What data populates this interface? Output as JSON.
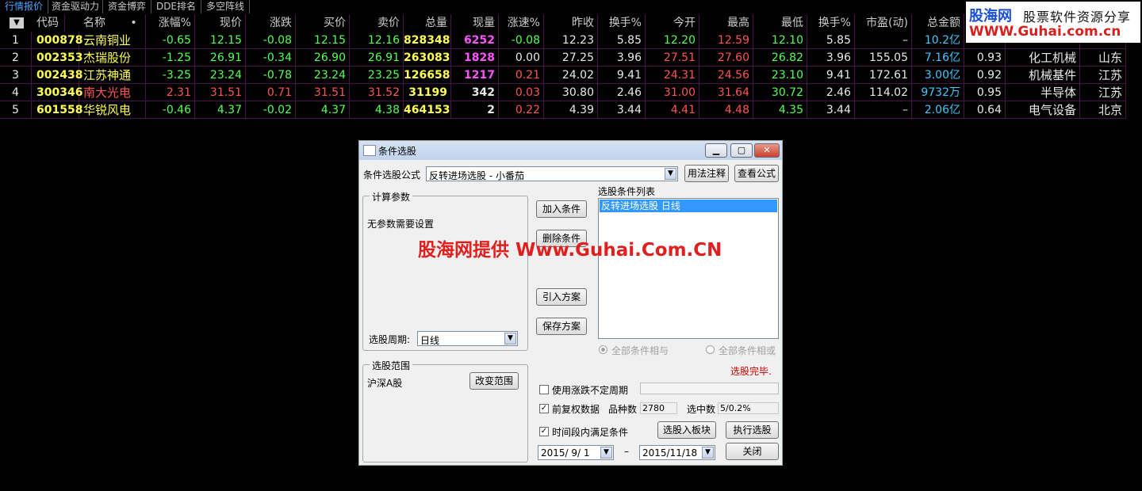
{
  "tabs": [
    "行情报价",
    "资金驱动力",
    "资金博弈",
    "DDE排名",
    "多空阵线"
  ],
  "table": {
    "headers": [
      "代码",
      "名称",
      "•",
      "涨幅%",
      "现价",
      "涨跌",
      "买价",
      "卖价",
      "总量",
      "现量",
      "涨速%",
      "昨收",
      "换手%",
      "今开",
      "最高",
      "最低",
      "换手%",
      "市盈(动)",
      "总金额"
    ],
    "rows": [
      {
        "idx": "1",
        "code": "000878",
        "name": "云南铜业",
        "chg_pct": "-0.65",
        "price": "12.15",
        "chg": "-0.08",
        "bid": "12.15",
        "ask": "12.16",
        "vol": "828348",
        "cur_vol": "6252",
        "speed": "-0.08",
        "prev": "12.23",
        "turn": "5.85",
        "open": "12.20",
        "high": "12.59",
        "low": "12.10",
        "turn2": "5.85",
        "pe": "–",
        "amount": "10.2亿",
        "ratio": "",
        "industry": "",
        "region": ""
      },
      {
        "idx": "2",
        "code": "002353",
        "name": "杰瑞股份",
        "chg_pct": "-1.25",
        "price": "26.91",
        "chg": "-0.34",
        "bid": "26.90",
        "ask": "26.91",
        "vol": "263083",
        "cur_vol": "1828",
        "speed": "0.00",
        "prev": "27.25",
        "turn": "3.96",
        "open": "27.51",
        "high": "27.60",
        "low": "26.82",
        "turn2": "3.96",
        "pe": "155.05",
        "amount": "7.16亿",
        "ratio": "0.93",
        "industry": "化工机械",
        "region": "山东"
      },
      {
        "idx": "3",
        "code": "002438",
        "name": "江苏神通",
        "chg_pct": "-3.25",
        "price": "23.24",
        "chg": "-0.78",
        "bid": "23.24",
        "ask": "23.25",
        "vol": "126658",
        "cur_vol": "1217",
        "speed": "0.21",
        "prev": "24.02",
        "turn": "9.41",
        "open": "24.31",
        "high": "24.56",
        "low": "23.10",
        "turn2": "9.41",
        "pe": "172.61",
        "amount": "3.00亿",
        "ratio": "0.92",
        "industry": "机械基件",
        "region": "江苏"
      },
      {
        "idx": "4",
        "code": "300346",
        "name": "南大光电",
        "chg_pct": "2.31",
        "price": "31.51",
        "chg": "0.71",
        "bid": "31.51",
        "ask": "31.52",
        "vol": "31199",
        "cur_vol": "342",
        "speed": "0.03",
        "prev": "30.80",
        "turn": "2.46",
        "open": "31.00",
        "high": "31.64",
        "low": "30.72",
        "turn2": "2.46",
        "pe": "114.02",
        "amount": "9732万",
        "ratio": "0.95",
        "industry": "半导体",
        "region": "江苏"
      },
      {
        "idx": "5",
        "code": "601558",
        "name": "华锐风电",
        "chg_pct": "-0.46",
        "price": "4.37",
        "chg": "-0.02",
        "bid": "4.37",
        "ask": "4.38",
        "vol": "464153",
        "cur_vol": "2",
        "speed": "0.22",
        "prev": "4.39",
        "turn": "3.44",
        "open": "4.41",
        "high": "4.48",
        "low": "4.35",
        "turn2": "3.44",
        "pe": "–",
        "amount": "2.06亿",
        "ratio": "0.64",
        "industry": "电气设备",
        "region": "北京"
      }
    ]
  },
  "watermark": {
    "brand": "股海网",
    "tagline": "股票软件资源分享",
    "url": "WWW.Guhai.com.cn"
  },
  "overlay_text": "股海网提供 Www.Guhai.Com.CN",
  "dialog": {
    "title": "条件选股",
    "formula_label": "条件选股公式",
    "formula_value": "反转进场选股 - 小番茄",
    "btn_usage": "用法注释",
    "btn_view": "查看公式",
    "params_group": "计算参数",
    "no_params": "无参数需要设置",
    "period_label": "选股周期:",
    "period_value": "日线",
    "btn_add": "加入条件",
    "btn_delete": "删除条件",
    "btn_import": "引入方案",
    "btn_save": "保存方案",
    "list_label": "选股条件列表",
    "list_items": [
      "反转进场选股  日线"
    ],
    "radio_and": "全部条件相与",
    "radio_or": "全部条件相或",
    "status": "选股完毕.",
    "range_group": "选股范围",
    "range_value": "沪深A股",
    "btn_change_range": "改变范围",
    "chk_unfixed": "使用涨跌不定周期",
    "chk_fq": "前复权数据",
    "count_label": "品种数",
    "count_value": "2780",
    "selected_label": "选中数",
    "selected_value": "5/0.2%",
    "chk_period": "时间段内满足条件",
    "btn_to_block": "选股入板块",
    "btn_run": "执行选股",
    "date_from": "2015/ 9/ 1",
    "date_to": "2015/11/18",
    "date_sep": "–",
    "btn_close": "关闭"
  },
  "colors": {
    "up": "#ff5454",
    "down": "#54ff54",
    "code": "#ffff54",
    "volume": "#ff54ff",
    "accent": "#3399ff"
  }
}
